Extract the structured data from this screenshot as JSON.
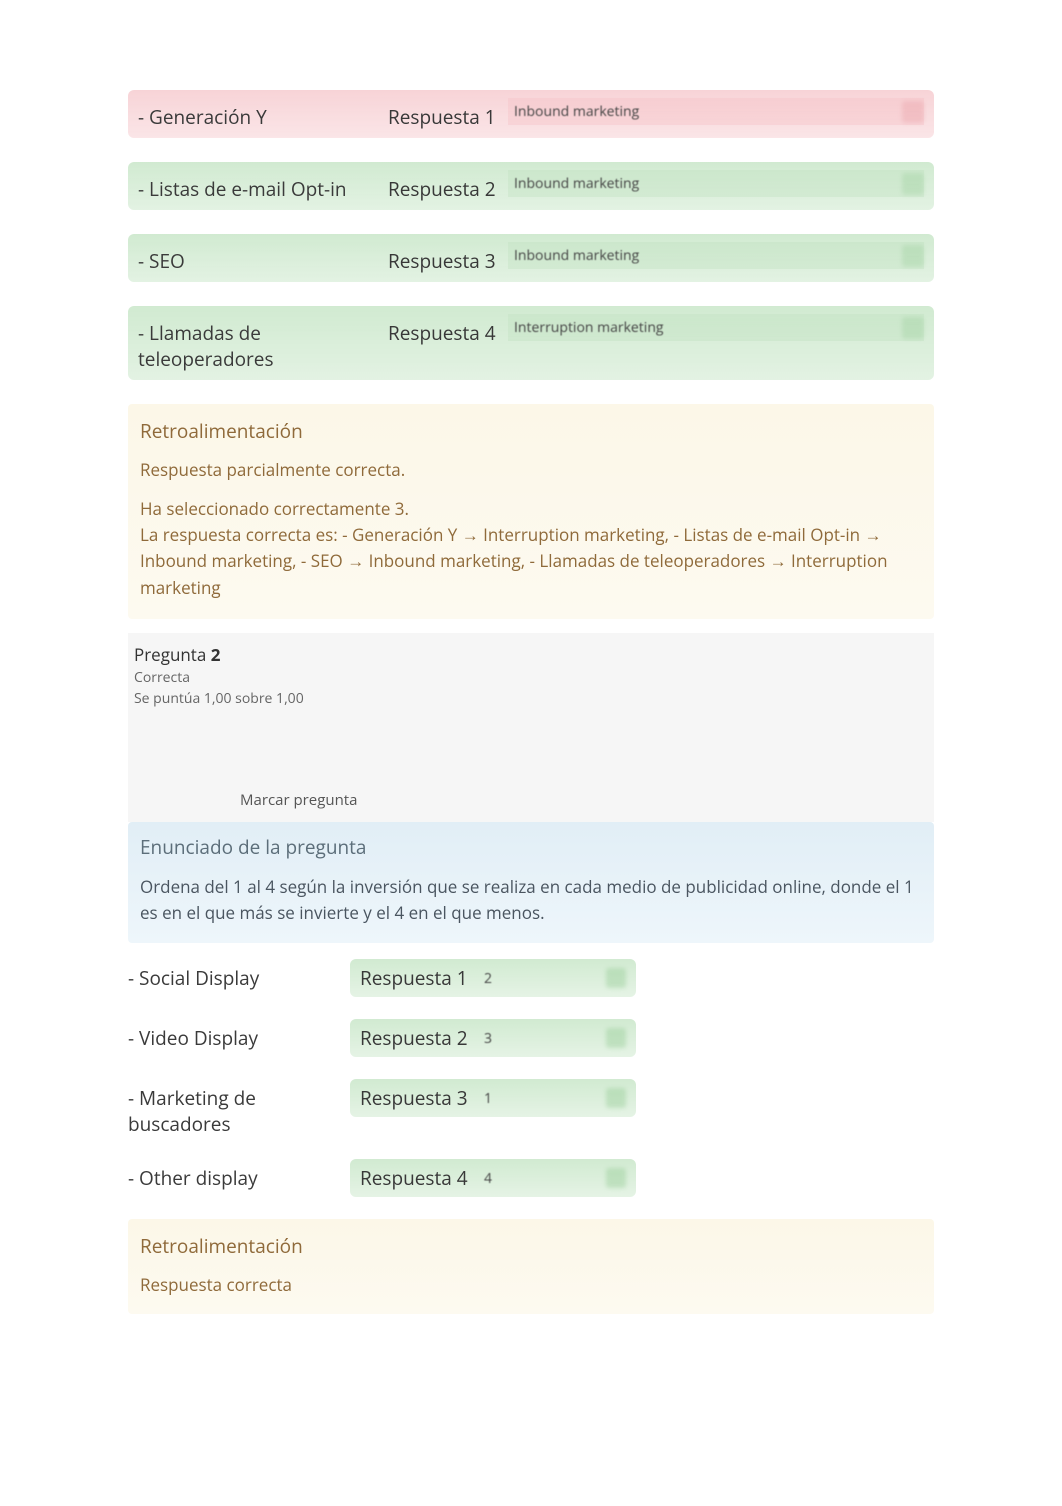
{
  "q1": {
    "rows": [
      {
        "prompt": "- Generación Y",
        "resp_label": "Respuesta 1",
        "value": "Inbound marketing",
        "state": "red"
      },
      {
        "prompt": "- Listas de e-mail Opt-in",
        "resp_label": "Respuesta 2",
        "value": "Inbound marketing",
        "state": "green"
      },
      {
        "prompt": "- SEO",
        "resp_label": "Respuesta 3",
        "value": "Inbound marketing",
        "state": "green"
      },
      {
        "prompt": "- Llamadas de teleoperadores",
        "resp_label": "Respuesta 4",
        "value": "Interruption marketing",
        "state": "green"
      }
    ],
    "feedback": {
      "title": "Retroalimentación",
      "status": "Respuesta parcialmente correcta.",
      "selected": "Ha seleccionado correctamente 3.",
      "correct": "La respuesta correcta es: - Generación Y → Interruption marketing, - Listas de e-mail Opt-in → Inbound marketing, - SEO → Inbound marketing, - Llamadas de teleoperadores → Interruption marketing"
    }
  },
  "q2": {
    "header": {
      "label": "Pregunta",
      "number": "2",
      "status": "Correcta",
      "score": "Se puntúa 1,00 sobre 1,00",
      "flag": "Marcar pregunta"
    },
    "enunciado": {
      "title": "Enunciado de la pregunta",
      "text": "Ordena del 1 al 4 según la inversión que se realiza en cada medio de publicidad online, donde el 1 es en el que más se invierte y el 4 en el que menos."
    },
    "rows": [
      {
        "prompt": "- Social Display",
        "resp_label": "Respuesta 1",
        "value": "2"
      },
      {
        "prompt": "- Video Display",
        "resp_label": "Respuesta 2",
        "value": "3"
      },
      {
        "prompt": "- Marketing de buscadores",
        "resp_label": "Respuesta 3",
        "value": "1"
      },
      {
        "prompt": "- Other display",
        "resp_label": "Respuesta 4",
        "value": "4"
      }
    ],
    "feedback": {
      "title": "Retroalimentación",
      "status": "Respuesta correcta"
    }
  }
}
